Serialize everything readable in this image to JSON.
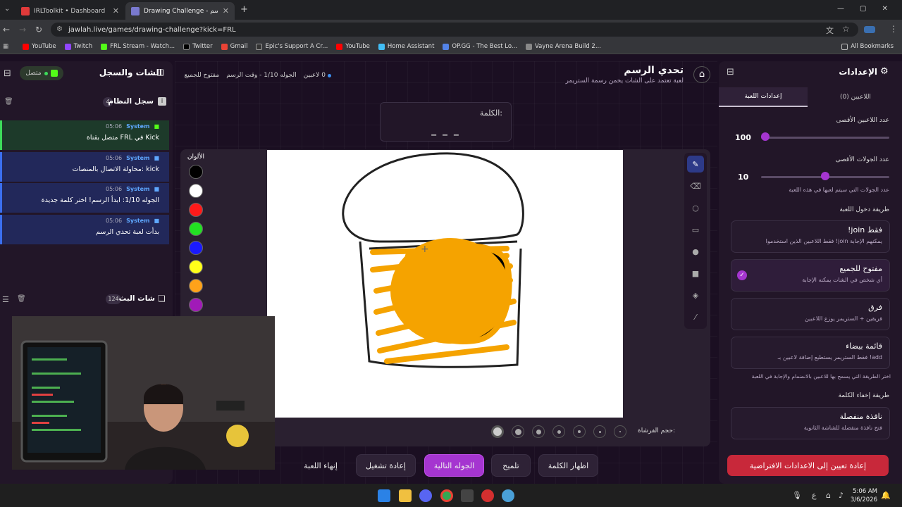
{
  "browser": {
    "tabs": [
      {
        "title": "IRLToolkit • Dashboard"
      },
      {
        "title": "Drawing Challenge - تحدي الرسم"
      }
    ],
    "url": "jawlah.live/games/drawing-challenge?kick=FRL",
    "bookmarks": [
      "YouTube",
      "Twitch",
      "FRL Stream - Watch...",
      "Twitter",
      "Gmail",
      "Epic's Support A Cr...",
      "YouTube",
      "Home Assistant",
      "OP.GG - The Best Lo...",
      "Vayne Arena Build 2..."
    ],
    "all_bookmarks": "All Bookmarks"
  },
  "header": {
    "title": "تحدي الرسم",
    "subtitle": "لعبة تعتمد على الشات يخمن رسمة الستريمر",
    "players": "0 لاعبين",
    "round": "الجوله 1/10 - وقت الرسم",
    "mode": "مفتوح للجميع"
  },
  "left": {
    "chat_title": "الشات والسجل",
    "status": "متصل",
    "log_title": "سجل النظام",
    "log_count": "4",
    "messages": [
      {
        "sender": "System",
        "time": "05:06",
        "text": "متصل بقناة FRL في Kick",
        "kind": "kick"
      },
      {
        "sender": "System",
        "time": "05:06",
        "text": "محاولة الاتصال بالمنصات: kick",
        "kind": "sys"
      },
      {
        "sender": "System",
        "time": "05:06",
        "text": "الجوله 1/10: ابدأ الرسم! اختر كلمة جديدة",
        "kind": "sys"
      },
      {
        "sender": "System",
        "time": "05:06",
        "text": "بدأت لعبة تحدي الرسم",
        "kind": "sys"
      }
    ],
    "stream_chat_title": "شات البث",
    "stream_chat_count": "124"
  },
  "word": {
    "label": "الكلمة:",
    "value": "_ _ _"
  },
  "palette": {
    "label": "الألوان",
    "colors": [
      "#000000",
      "#ffffff",
      "#ff1a1a",
      "#22e022",
      "#1a1aff",
      "#ffff1a",
      "#ffa21a",
      "#a11ab8"
    ]
  },
  "brush": {
    "label": "حجم الفرشاة:"
  },
  "buttons": {
    "show_word": "اظهار الكلمة",
    "hint": "تلميح",
    "next_round": "الجوله التالية",
    "restart": "إعادة تشغيل",
    "end_game": "إنهاء اللعبة"
  },
  "settings": {
    "title": "الإعدادات",
    "tab_players": "اللاعبين (0)",
    "tab_game": "إعدادات اللعبة",
    "max_players_label": "عدد اللاعبين الأقصى",
    "max_players": 100,
    "max_rounds_label": "عدد الجولات الأقصى",
    "max_rounds": 10,
    "max_rounds_hint": "عدد الجولات التي سيتم لعبها في هذه اللعبة",
    "join_label": "طريقة دخول اللعبة",
    "join_options": [
      {
        "title": "!join فقط",
        "desc": "فقط اللاعبين الذين استخدموا !join يمكنهم الإجابة"
      },
      {
        "title": "مفتوح للجميع",
        "desc": "أي شخص في الشات يمكنه الإجابة",
        "selected": true
      },
      {
        "title": "فرق",
        "desc": "فريقين + الستريمر يوزع اللاعبين"
      },
      {
        "title": "قائمة بيضاء",
        "desc": "فقط الستريمر يستطيع إضافة لاعبين بـ !add"
      }
    ],
    "join_hint": "اختر الطريقة التي يسمح بها للاعبين بالانضمام والإجابة في اللعبة",
    "hide_label": "طريقة إخفاء الكلمة",
    "hide_option": {
      "title": "نافذة منفصلة",
      "desc": "فتح نافذة منفصلة للشاشة الثانوية"
    },
    "reset": "إعادة تعيين إلى الاعدادات الافتراضية"
  },
  "taskbar": {
    "time": "5:06 AM",
    "date": "3/6/2026",
    "lang": "ع"
  }
}
